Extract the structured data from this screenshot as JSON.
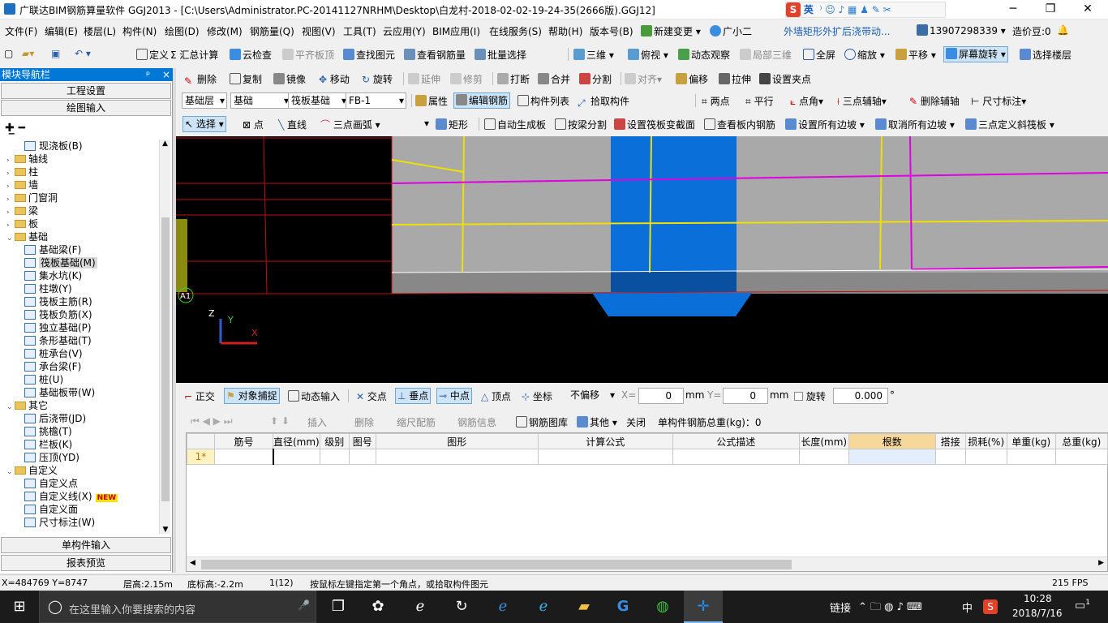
{
  "window": {
    "title": "广联达BIM钢筋算量软件 GGJ2013 - [C:\\Users\\Administrator.PC-20141127NRHM\\Desktop\\白龙村-2018-02-02-19-24-35(2666版).GGJ12]",
    "ime_label": "英",
    "minimize": "─",
    "maximize": "❐",
    "close": "✕"
  },
  "menu": {
    "items": [
      "文件(F)",
      "编辑(E)",
      "楼层(L)",
      "构件(N)",
      "绘图(D)",
      "修改(M)",
      "钢筋量(Q)",
      "视图(V)",
      "工具(T)",
      "云应用(Y)",
      "BIM应用(I)",
      "在线服务(S)",
      "帮助(H)",
      "版本号(B)",
      "新建变更",
      "广小二"
    ],
    "news": "外墙矩形外扩后浇带动...",
    "phone": "13907298339",
    "beans": "造价豆:0"
  },
  "toolbar1": [
    "定义",
    "汇总计算",
    "云检查",
    "平齐板顶",
    "查找图元",
    "查看钢筋量",
    "批量选择",
    "三维",
    "俯视",
    "动态观察",
    "局部三维",
    "全屏",
    "缩放",
    "平移",
    "屏幕旋转",
    "选择楼层"
  ],
  "toolbar2": [
    "删除",
    "复制",
    "镜像",
    "移动",
    "旋转",
    "延伸",
    "修剪",
    "打断",
    "合并",
    "分割",
    "对齐",
    "偏移",
    "拉伸",
    "设置夹点"
  ],
  "toolbar3": {
    "layer": "基础层",
    "category": "基础",
    "type": "筏板基础",
    "name": "FB-1",
    "buttons": [
      "属性",
      "编辑钢筋",
      "构件列表",
      "拾取构件",
      "两点",
      "平行",
      "点角",
      "三点辅轴",
      "删除辅轴",
      "尺寸标注"
    ]
  },
  "toolbar4": [
    "选择",
    "点",
    "直线",
    "三点画弧",
    "矩形",
    "自动生成板",
    "按梁分割",
    "设置筏板变截面",
    "查看板内钢筋",
    "设置所有边坡",
    "取消所有边坡",
    "三点定义斜筏板"
  ],
  "nav": {
    "header": "模块导航栏",
    "pin": "ᵖ",
    "close": "×",
    "tab_top1": "工程设置",
    "tab_top2": "绘图输入",
    "tab_bottom1": "单构件输入",
    "tab_bottom2": "报表预览",
    "tree": [
      {
        "label": "现浇板(B)",
        "level": 2,
        "folder": false
      },
      {
        "label": "轴线",
        "level": 1,
        "folder": true,
        "toggle": "›"
      },
      {
        "label": "柱",
        "level": 1,
        "folder": true,
        "toggle": "›"
      },
      {
        "label": "墙",
        "level": 1,
        "folder": true,
        "toggle": "›"
      },
      {
        "label": "门窗洞",
        "level": 1,
        "folder": true,
        "toggle": "›"
      },
      {
        "label": "梁",
        "level": 1,
        "folder": true,
        "toggle": "›"
      },
      {
        "label": "板",
        "level": 1,
        "folder": true,
        "toggle": "›"
      },
      {
        "label": "基础",
        "level": 1,
        "folder": true,
        "toggle": "⌄"
      },
      {
        "label": "基础梁(F)",
        "level": 2,
        "folder": false
      },
      {
        "label": "筏板基础(M)",
        "level": 2,
        "folder": false,
        "selected": true
      },
      {
        "label": "集水坑(K)",
        "level": 2,
        "folder": false
      },
      {
        "label": "柱墩(Y)",
        "level": 2,
        "folder": false
      },
      {
        "label": "筏板主筋(R)",
        "level": 2,
        "folder": false
      },
      {
        "label": "筏板负筋(X)",
        "level": 2,
        "folder": false
      },
      {
        "label": "独立基础(P)",
        "level": 2,
        "folder": false
      },
      {
        "label": "条形基础(T)",
        "level": 2,
        "folder": false
      },
      {
        "label": "桩承台(V)",
        "level": 2,
        "folder": false
      },
      {
        "label": "承台梁(F)",
        "level": 2,
        "folder": false
      },
      {
        "label": "桩(U)",
        "level": 2,
        "folder": false
      },
      {
        "label": "基础板带(W)",
        "level": 2,
        "folder": false
      },
      {
        "label": "其它",
        "level": 1,
        "folder": true,
        "toggle": "⌄"
      },
      {
        "label": "后浇带(JD)",
        "level": 2,
        "folder": false
      },
      {
        "label": "挑檐(T)",
        "level": 2,
        "folder": false
      },
      {
        "label": "栏板(K)",
        "level": 2,
        "folder": false
      },
      {
        "label": "压顶(YD)",
        "level": 2,
        "folder": false
      },
      {
        "label": "自定义",
        "level": 1,
        "folder": true,
        "toggle": "⌄"
      },
      {
        "label": "自定义点",
        "level": 2,
        "folder": false
      },
      {
        "label": "自定义线(X)",
        "level": 2,
        "folder": false,
        "badge": "NEW"
      },
      {
        "label": "自定义面",
        "level": 2,
        "folder": false
      },
      {
        "label": "尺寸标注(W)",
        "level": 2,
        "folder": false
      }
    ]
  },
  "canvas": {
    "axis_label": "A1",
    "z": "Z",
    "y": "Y",
    "x": "X"
  },
  "snapbar": {
    "items": [
      "正交",
      "对象捕捉",
      "动态输入",
      "交点",
      "垂点",
      "中点",
      "顶点",
      "坐标"
    ],
    "offset_mode": "不偏移",
    "x_label": "X=",
    "x_value": "0",
    "y_label": "Y=",
    "y_value": "0",
    "unit": "mm",
    "rotate_label": "旋转",
    "rotate_value": "0.000",
    "degree": "°"
  },
  "gridbar": {
    "items": [
      "插入",
      "删除",
      "缩尺配筋",
      "钢筋信息",
      "钢筋图库",
      "其他",
      "关闭"
    ],
    "total": "单构件钢筋总重(kg)：0"
  },
  "grid": {
    "columns": [
      "",
      "筋号",
      "直径(mm)",
      "级别",
      "图号",
      "图形",
      "计算公式",
      "公式描述",
      "长度(mm)",
      "根数",
      "搭接",
      "损耗(%)",
      "单重(kg)",
      "总重(kg)"
    ],
    "rows": [
      [
        "1*",
        "",
        "",
        "",
        "",
        "",
        "",
        "",
        "",
        "",
        "",
        "",
        "",
        ""
      ]
    ]
  },
  "status": {
    "coords": "X=484769 Y=8747",
    "floor_height": "层高:2.15m",
    "bottom_height": "底标高:-2.2m",
    "count": "1(12)",
    "hint": "按鼠标左键指定第一个角点，或拾取构件图元",
    "fps": "215 FPS"
  },
  "taskbar": {
    "search_placeholder": "在这里输入你要搜索的内容",
    "link": "链接",
    "lang": "中",
    "time": "10:28",
    "date": "2018/7/16",
    "notify": "1"
  },
  "colors": {
    "accent": "#0078d7",
    "canvas_bg": "#000000",
    "slab_gray": "#a9a9a9",
    "blue_member": "#0a6fd8",
    "yellow_line": "#f0e000",
    "magenta_line": "#e000e0",
    "red_line": "#e01010"
  }
}
